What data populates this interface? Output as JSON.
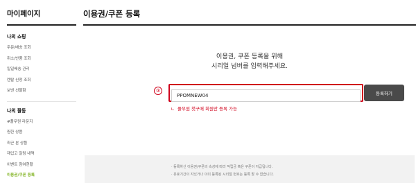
{
  "sidebar": {
    "title": "마이페이지",
    "shopping": {
      "heading": "나의 쇼핑",
      "items": [
        {
          "label": "주문/배송 조회"
        },
        {
          "label": "취소/반품 조회"
        },
        {
          "label": "일일배송 관리"
        },
        {
          "label": "렌탈 신청 조회"
        },
        {
          "label": "보낸 선물함"
        }
      ]
    },
    "activity": {
      "heading": "나의 활동",
      "items": [
        {
          "label": "#풀무원 라운지"
        },
        {
          "label": "찜한 상품"
        },
        {
          "label": "최근 본 상품"
        },
        {
          "label": "재입고 알림 내역"
        },
        {
          "label": "이벤트 참여현황"
        },
        {
          "label": "이용권/쿠폰 등록",
          "active": true
        }
      ]
    }
  },
  "main": {
    "title": "이용권/쿠폰 등록",
    "intro_line1": "이용권, 쿠폰 등록을 위해",
    "intro_line2": "시리얼 넘버를 입력해주세요.",
    "step_number": "③",
    "code_input": {
      "value": "PPOMNEW04"
    },
    "submit_label": "등록하기",
    "note_arrow": "ㄴ",
    "note": "풀무원 첫구매 회원만 등록 가능",
    "info": [
      "· 등록하신 이용권/쿠폰의 속성에 따라 적립금 혹은 쿠폰이 지급됩니다.",
      "· 유효기간이 지났거나 이미 등록된 시리얼 번호는 등록 할 수 없습니다."
    ]
  },
  "colors": {
    "accent_green": "#7fb21f",
    "highlight_red": "#d0021b",
    "button_dark": "#4a4a4a"
  }
}
